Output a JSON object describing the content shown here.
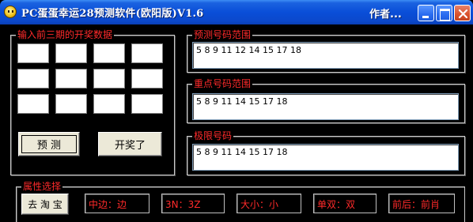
{
  "window": {
    "title": "PC蛋蛋幸运28预测软件(欧阳版)V1.6",
    "author": "作者...",
    "icon": "smiley-app-icon"
  },
  "input_group": {
    "label": "输入前三期的开奖数据",
    "cells": [
      "",
      "",
      "",
      "",
      "",
      "",
      "",
      "",
      "",
      "",
      "",
      ""
    ],
    "predict_button": "预 测",
    "draw_button": "开奖了"
  },
  "range_group": {
    "label": "预测号码范围",
    "value": "5 8 9 11 12 14 15 17 18"
  },
  "key_group": {
    "label": "重点号码范围",
    "value": "5 8 9 11 14 15 17 18"
  },
  "limit_group": {
    "label": "极限号码",
    "value": "5 8 9 11 14 15 17 18"
  },
  "attr_group": {
    "label": "属性选择",
    "taobao_button": "去 淘 宝",
    "items": [
      "中边：边",
      "3N：3Z",
      "大小：小",
      "单双：双",
      "前后：前肖"
    ]
  },
  "colors": {
    "accent_red": "#ff2a2a",
    "background": "#000000",
    "titlebar_blue": "#0a4ed8"
  }
}
